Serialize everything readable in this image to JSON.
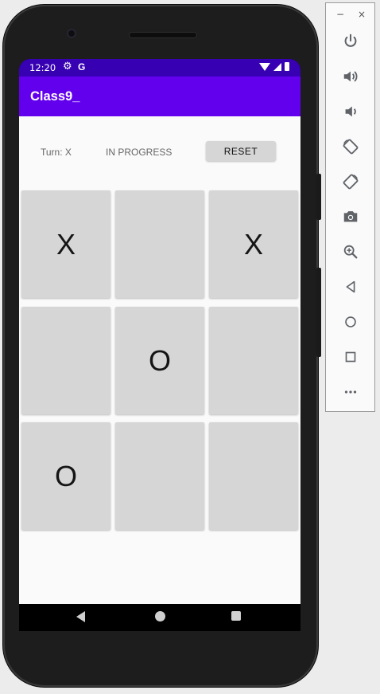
{
  "status_bar": {
    "time": "12:20",
    "gear_glyph": "⚙",
    "google_glyph": "G"
  },
  "app": {
    "title": "Class9_",
    "accent_color": "#6200ee",
    "status_color": "#3700b3"
  },
  "game": {
    "turn_label": "Turn: X",
    "status_label": "IN PROGRESS",
    "reset_label": "RESET",
    "board": [
      "X",
      "",
      "X",
      "",
      "O",
      "",
      "O",
      "",
      ""
    ]
  },
  "nav_bar": {
    "icons": [
      "back-icon",
      "home-icon",
      "recents-icon"
    ]
  },
  "emulator_toolbar": {
    "minimize_glyph": "−",
    "close_glyph": "×",
    "buttons": [
      "power-icon",
      "volume-up-icon",
      "volume-down-icon",
      "rotate-left-icon",
      "rotate-right-icon",
      "camera-icon",
      "zoom-icon",
      "back-icon",
      "home-icon",
      "overview-icon",
      "more-icon"
    ]
  }
}
